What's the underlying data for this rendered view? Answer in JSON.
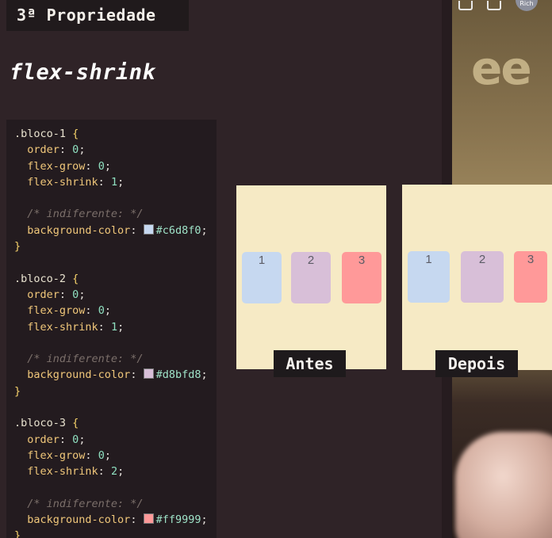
{
  "header": {
    "property_tag": "3ª Propriedade",
    "property_title": "flex-shrink"
  },
  "code": {
    "blocks": [
      {
        "selector": ".bloco-1",
        "order_prop": "order",
        "order_val": "0",
        "grow_prop": "flex-grow",
        "grow_val": "0",
        "shrink_prop": "flex-shrink",
        "shrink_val": "1",
        "comment": "/* indiferente: */",
        "bg_prop": "background-color",
        "bg_val": "#c6d8f0"
      },
      {
        "selector": ".bloco-2",
        "order_prop": "order",
        "order_val": "0",
        "grow_prop": "flex-grow",
        "grow_val": "0",
        "shrink_prop": "flex-shrink",
        "shrink_val": "1",
        "comment": "/* indiferente: */",
        "bg_prop": "background-color",
        "bg_val": "#d8bfd8"
      },
      {
        "selector": ".bloco-3",
        "order_prop": "order",
        "order_val": "0",
        "grow_prop": "flex-grow",
        "grow_val": "0",
        "shrink_prop": "flex-shrink",
        "shrink_val": "2",
        "comment": "/* indiferente: */",
        "bg_prop": "background-color",
        "bg_val": "#ff9999"
      }
    ],
    "open_brace": "{",
    "close_brace": "}"
  },
  "demo": {
    "antes": {
      "label": "Antes",
      "blocks": [
        "1",
        "2",
        "3"
      ]
    },
    "depois": {
      "label": "Depois",
      "blocks": [
        "1",
        "2",
        "3"
      ]
    }
  },
  "video": {
    "overlay_text": "ee",
    "avatar_text": "Rich"
  },
  "colors": {
    "bloco1": "#c6d8f0",
    "bloco2": "#d8bfd8",
    "bloco3": "#ff9999",
    "demo_bg": "#f6eac5"
  }
}
